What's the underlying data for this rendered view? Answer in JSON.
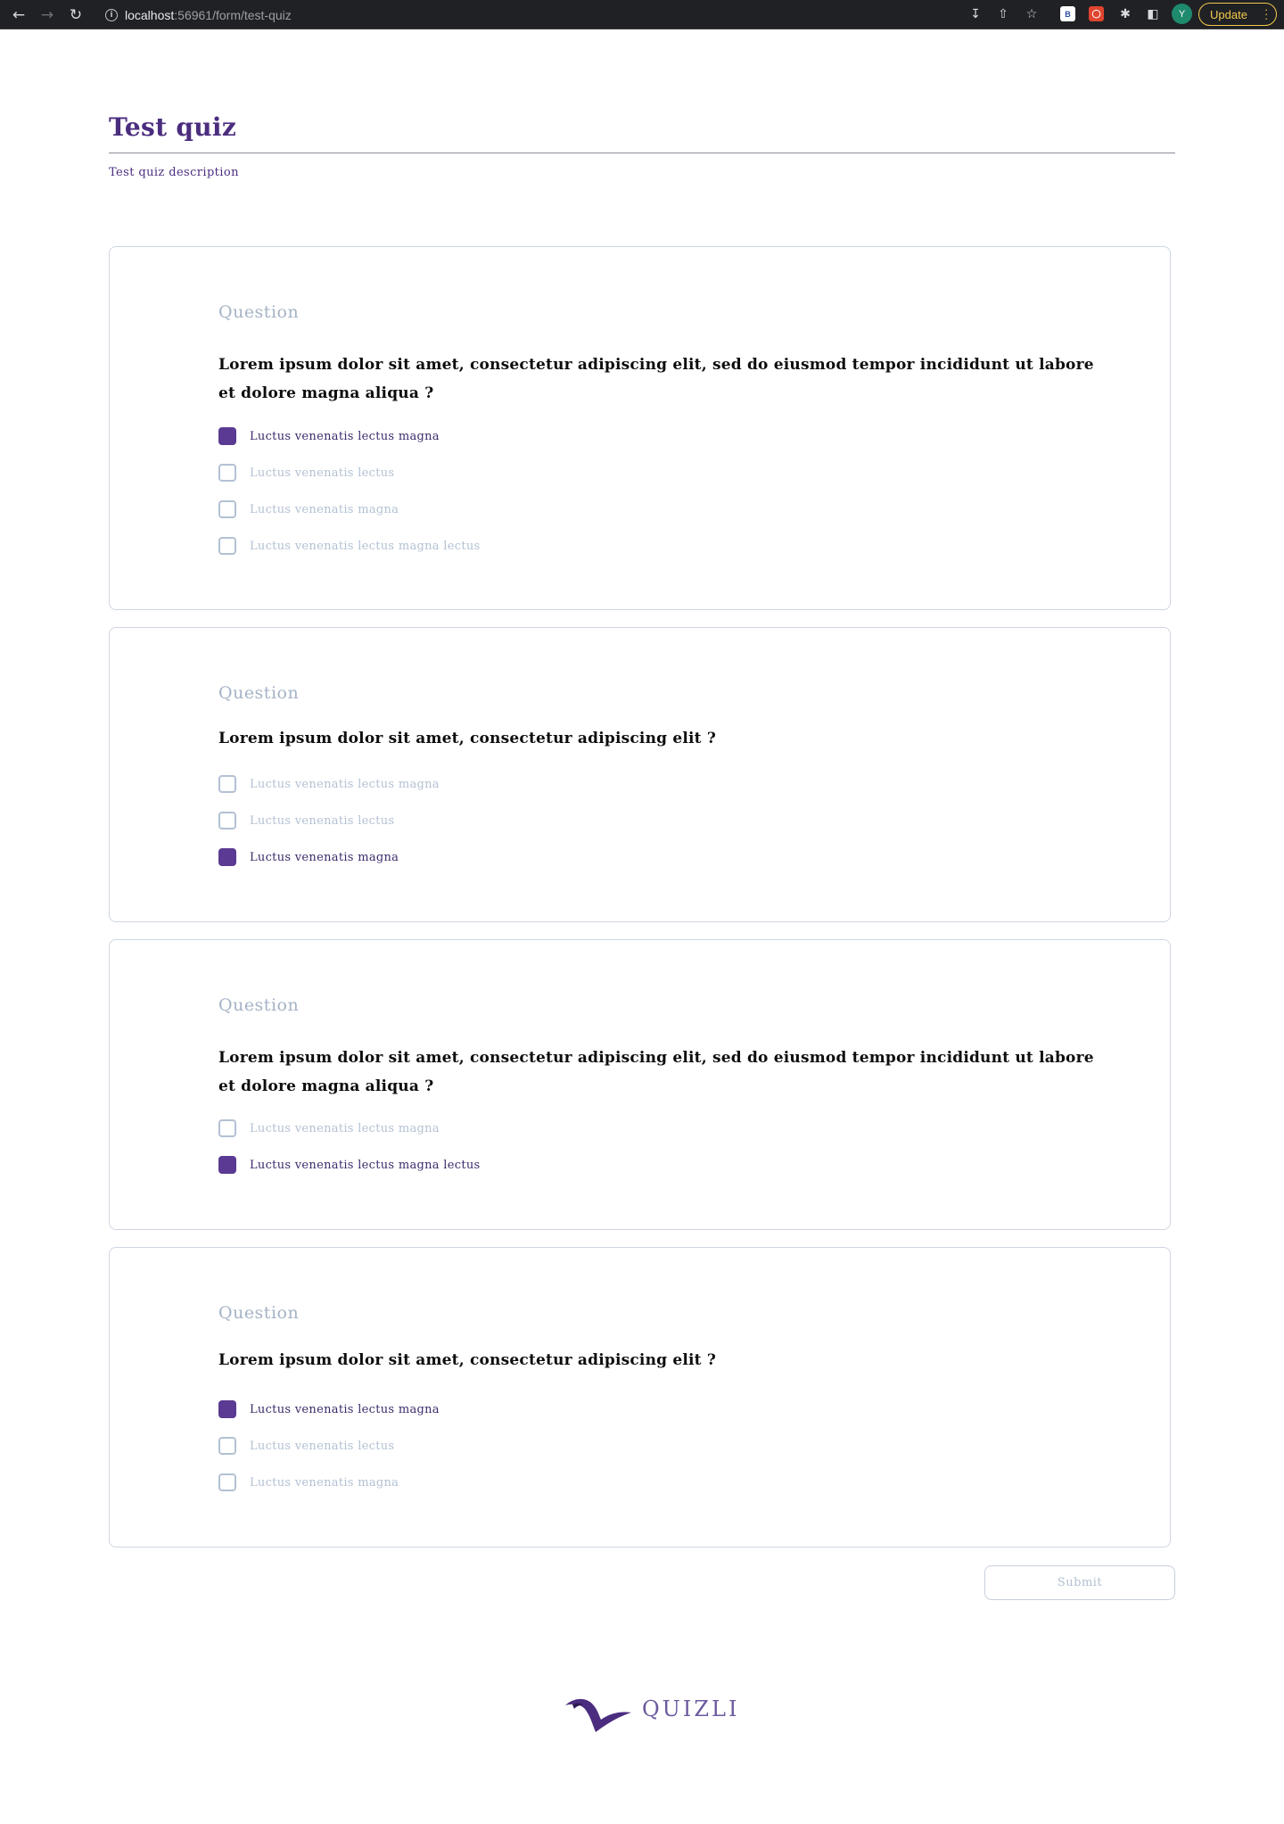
{
  "browser": {
    "url_host": "localhost",
    "url_path": ":56961/form/test-quiz",
    "update_label": "Update",
    "avatar_initial": "Y",
    "ext_b_label": "B"
  },
  "form": {
    "title": "Test quiz",
    "description": "Test quiz description",
    "submit_label": "Submit"
  },
  "questions": [
    {
      "label": "Question",
      "text": "Lorem ipsum dolor sit amet, consectetur adipiscing elit, sed do eiusmod tempor incididunt ut labore et dolore magna aliqua ?",
      "options": [
        {
          "text": "Luctus venenatis lectus magna",
          "checked": true
        },
        {
          "text": "Luctus venenatis lectus",
          "checked": false
        },
        {
          "text": "Luctus venenatis magna",
          "checked": false
        },
        {
          "text": "Luctus venenatis lectus magna lectus",
          "checked": false
        }
      ]
    },
    {
      "label": "Question",
      "text": "Lorem ipsum dolor sit amet, consectetur adipiscing elit ?",
      "options": [
        {
          "text": "Luctus venenatis lectus magna",
          "checked": false
        },
        {
          "text": "Luctus venenatis lectus",
          "checked": false
        },
        {
          "text": "Luctus venenatis magna",
          "checked": true
        }
      ]
    },
    {
      "label": "Question",
      "text": "Lorem ipsum dolor sit amet, consectetur adipiscing elit, sed do eiusmod tempor incididunt ut labore et dolore magna aliqua ?",
      "options": [
        {
          "text": "Luctus venenatis lectus magna",
          "checked": false
        },
        {
          "text": "Luctus venenatis lectus magna lectus",
          "checked": true
        }
      ]
    },
    {
      "label": "Question",
      "text": "Lorem ipsum dolor sit amet, consectetur adipiscing elit ?",
      "options": [
        {
          "text": "Luctus venenatis lectus magna",
          "checked": true
        },
        {
          "text": "Luctus venenatis lectus",
          "checked": false
        },
        {
          "text": "Luctus venenatis magna",
          "checked": false
        }
      ]
    }
  ],
  "footer": {
    "logo_text": "QUIZLI"
  },
  "colors": {
    "brand": "#4b2d7f",
    "checked": "#5a3a92",
    "muted": "#b3c1d3"
  }
}
